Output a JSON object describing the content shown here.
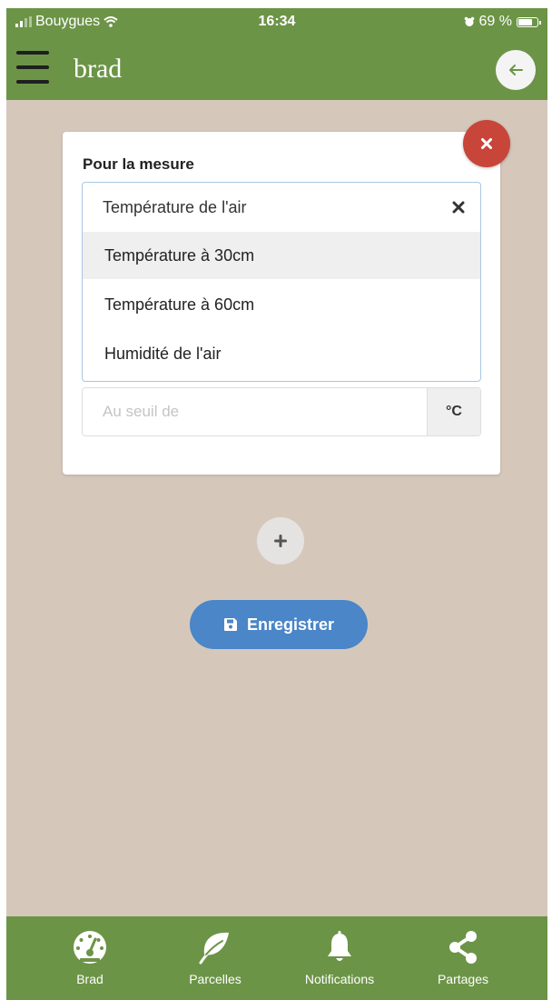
{
  "status_bar": {
    "carrier": "Bouygues",
    "time": "16:34",
    "battery": "69 %"
  },
  "header": {
    "title": "brad",
    "menu_icon": "hamburger-icon",
    "back_icon": "arrow-left-icon"
  },
  "form": {
    "field_label": "Pour la mesure",
    "measure_select": {
      "selected": "Température de l'air",
      "clear_icon": "times-icon",
      "options": [
        "Température à 30cm",
        "Température à 60cm",
        "Humidité de l'air"
      ],
      "highlighted_index": 0
    },
    "threshold": {
      "placeholder": "Au seuil de",
      "value": "",
      "unit": "°C"
    },
    "close_icon": "times-icon"
  },
  "actions": {
    "add_icon": "plus-icon",
    "save_label": "Enregistrer",
    "save_icon": "floppy-disk-icon"
  },
  "bottom_nav": {
    "items": [
      {
        "label": "Brad",
        "icon": "dashboard-gauge-icon"
      },
      {
        "label": "Parcelles",
        "icon": "leaf-icon"
      },
      {
        "label": "Notifications",
        "icon": "bell-icon"
      },
      {
        "label": "Partages",
        "icon": "share-icon"
      }
    ]
  },
  "colors": {
    "header_green": "#6c9447",
    "background": "#d5c8bb",
    "close_red": "#c8453a",
    "save_blue": "#4a86c8"
  }
}
